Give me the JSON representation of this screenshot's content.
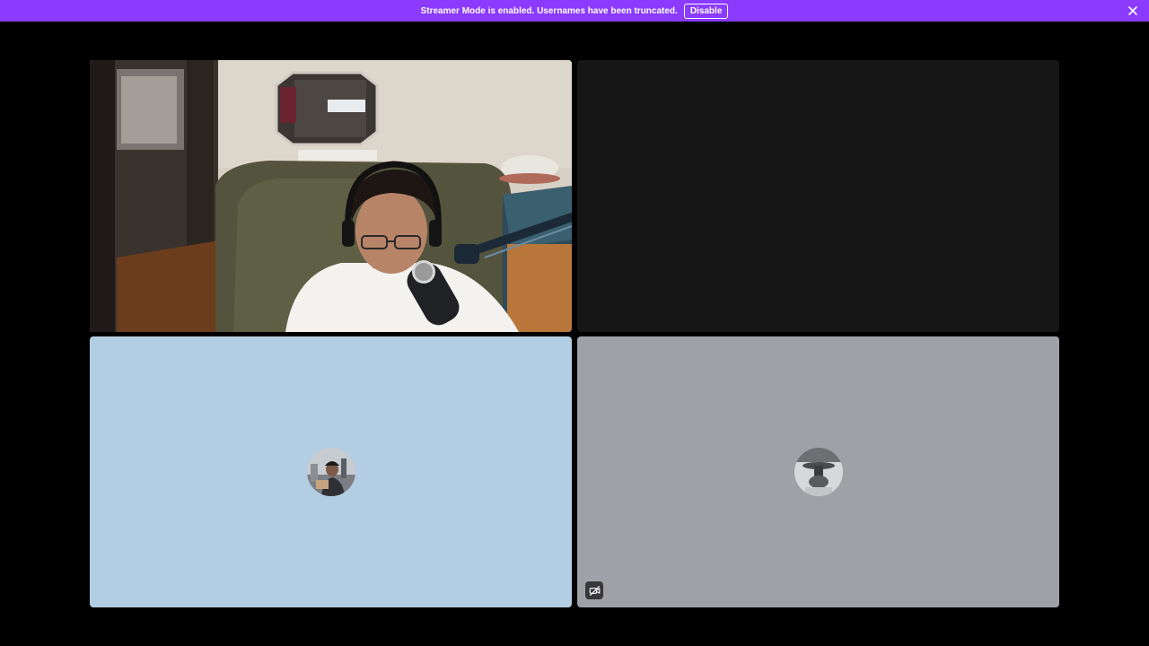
{
  "banner": {
    "message": "Streamer Mode is enabled. Usernames have been truncated.",
    "disable_label": "Disable",
    "color": "#8b3aff"
  },
  "tiles": [
    {
      "name": "participant-webcam",
      "state": "camera-on"
    },
    {
      "name": "participant-empty",
      "state": "dark",
      "color": "#161616"
    },
    {
      "name": "participant-avatar-1",
      "state": "avatar",
      "color": "#b3cde3"
    },
    {
      "name": "participant-avatar-2",
      "state": "avatar",
      "color": "#a0a1a6",
      "badge_icon": "video-off-icon"
    }
  ]
}
